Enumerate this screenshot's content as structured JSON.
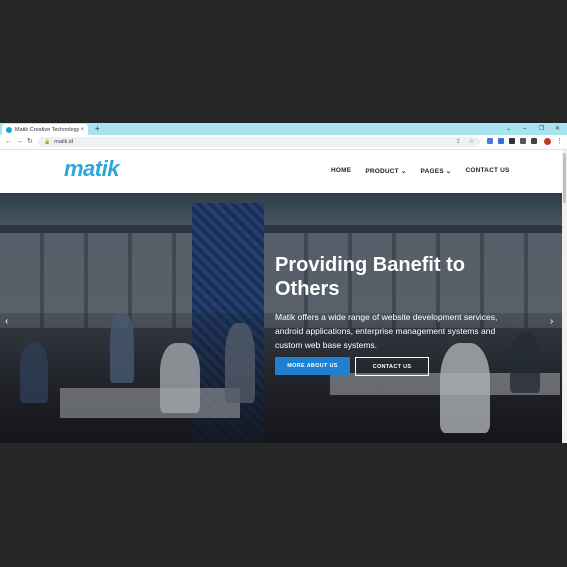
{
  "browser": {
    "tab_title": "Matik Creative Technology",
    "tab_close": "×",
    "new_tab": "+",
    "window_controls": [
      "⌄",
      "–",
      "❐",
      "✕"
    ],
    "url": "matik.id"
  },
  "site": {
    "logo": "matik",
    "nav": [
      "HOME",
      "PRODUCT ⌄",
      "PAGES ⌄",
      "CONTACT US"
    ]
  },
  "hero": {
    "title": "Providing Banefit to Others",
    "text": "Matik offers a wide range of website development services, android applications, enterprise management systems and custom web base systems.",
    "primary_button": "MORE ABOUT US",
    "secondary_button": "CONTACT US",
    "prev_icon": "‹",
    "next_icon": "›"
  },
  "colors": {
    "tab_strip": "#a9e3ef",
    "brand": "#2da7d9",
    "primary_button": "#1f7fd1"
  }
}
